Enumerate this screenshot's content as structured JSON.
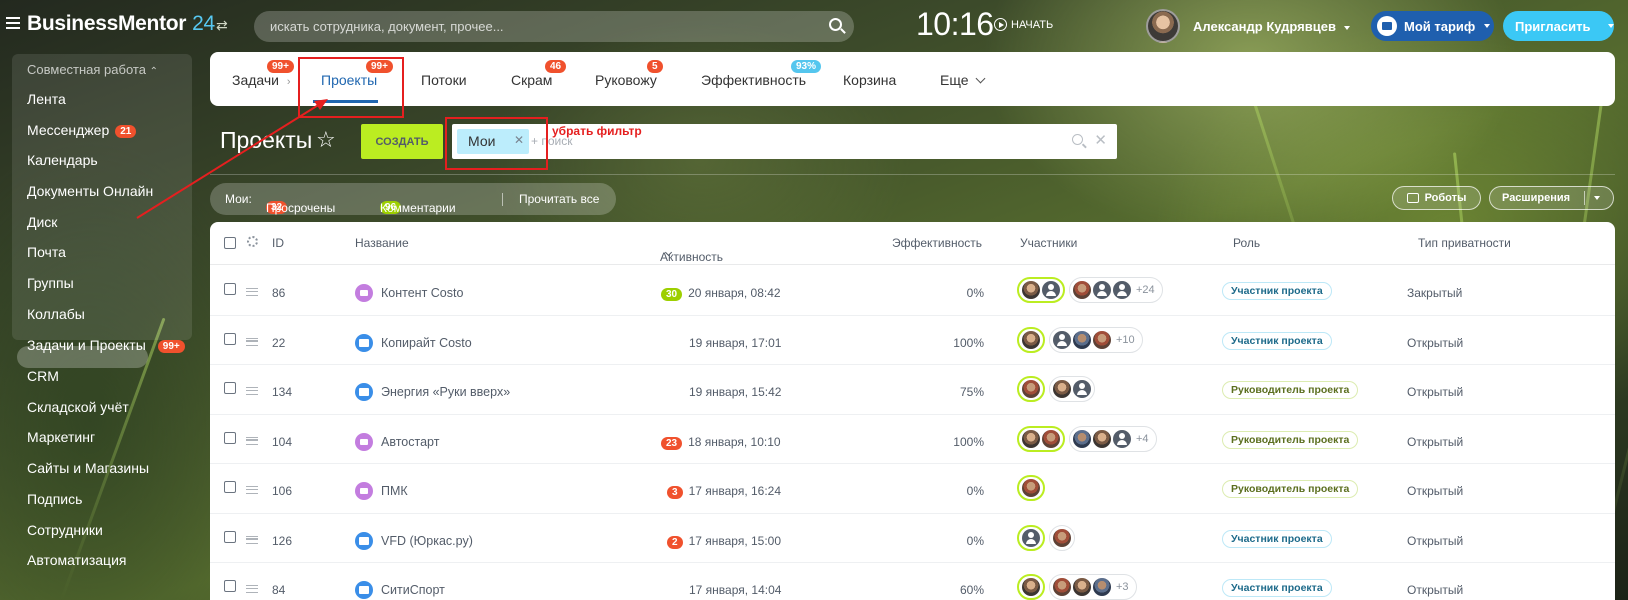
{
  "topbar": {
    "logo_brand": "BusinessMentor",
    "logo_num": "24",
    "search_placeholder": "искать сотрудника, документ, прочее...",
    "clock": "10:16",
    "start_label": "НАЧАТЬ",
    "user_name": "Александр Кудрявцев",
    "tariff_label": "Мой тариф",
    "invite_label": "Пригласить"
  },
  "sidebar": {
    "group_label": "Совместная работа",
    "items": [
      {
        "label": "Лента"
      },
      {
        "label": "Мессенджер",
        "badge": "21"
      },
      {
        "label": "Календарь"
      },
      {
        "label": "Документы Онлайн"
      },
      {
        "label": "Диск"
      },
      {
        "label": "Почта"
      },
      {
        "label": "Группы"
      },
      {
        "label": "Коллабы"
      },
      {
        "label": "Задачи и Проекты",
        "badge": "99+"
      },
      {
        "label": "CRM"
      },
      {
        "label": "Складской учёт"
      },
      {
        "label": "Маркетинг"
      },
      {
        "label": "Сайты и Магазины"
      },
      {
        "label": "Подпись"
      },
      {
        "label": "Сотрудники"
      },
      {
        "label": "Автоматизация"
      }
    ]
  },
  "tabs": [
    {
      "label": "Задачи",
      "badge": "99+"
    },
    {
      "label": "Проекты",
      "badge": "99+",
      "active": true
    },
    {
      "label": "Потоки"
    },
    {
      "label": "Скрам",
      "badge": "46"
    },
    {
      "label": "Руковожу",
      "badge": "5"
    },
    {
      "label": "Эффективность",
      "badge": "93%"
    },
    {
      "label": "Корзина"
    },
    {
      "label": "Еще"
    }
  ],
  "page": {
    "title": "Проекты",
    "create_label": "СОЗДАТЬ",
    "filter_chip": "Мои",
    "filter_placeholder": "+ поиск",
    "annotation": "убрать фильтр"
  },
  "counters": {
    "label": "Мои:",
    "overdue_count": "32",
    "overdue_label": "Просрочены",
    "comments_count": "96",
    "comments_label": "Комментарии",
    "read_all": "Прочитать все"
  },
  "actions": {
    "robots_label": "Роботы",
    "extensions_label": "Расширения"
  },
  "columns": {
    "id": "ID",
    "name": "Название",
    "activity": "Активность",
    "efficiency": "Эффективность",
    "members": "Участники",
    "role": "Роль",
    "privacy": "Тип приватности"
  },
  "rows": [
    {
      "id": "86",
      "name": "Контент Costo",
      "icon": "purple",
      "activity_badge": "30",
      "activity_badge_color": "green",
      "activity": "20 января, 08:42",
      "efficiency": "0%",
      "more": "+24",
      "role": "Участник проекта",
      "role_kind": "member",
      "privacy": "Закрытый"
    },
    {
      "id": "22",
      "name": "Копирайт Costo",
      "icon": "blue",
      "activity_badge": "",
      "activity": "19 января, 17:01",
      "efficiency": "100%",
      "more": "+10",
      "role": "Участник проекта",
      "role_kind": "member",
      "privacy": "Открытый"
    },
    {
      "id": "134",
      "name": "Энергия «Руки вверх»",
      "icon": "blue",
      "activity_badge": "",
      "activity": "19 января, 15:42",
      "efficiency": "75%",
      "more": "",
      "role": "Руководитель проекта",
      "role_kind": "owner",
      "privacy": "Открытый"
    },
    {
      "id": "104",
      "name": "Автостарт",
      "icon": "purple",
      "activity_badge": "23",
      "activity_badge_color": "red",
      "activity": "18 января, 10:10",
      "efficiency": "100%",
      "more": "+4",
      "role": "Руководитель проекта",
      "role_kind": "owner",
      "privacy": "Открытый"
    },
    {
      "id": "106",
      "name": "ПМК",
      "icon": "purple",
      "activity_badge": "3",
      "activity_badge_color": "red",
      "activity": "17 января, 16:24",
      "efficiency": "0%",
      "more": "",
      "role": "Руководитель проекта",
      "role_kind": "owner",
      "privacy": "Открытый"
    },
    {
      "id": "126",
      "name": "VFD (Юркас.ру)",
      "icon": "blue",
      "activity_badge": "2",
      "activity_badge_color": "red",
      "activity": "17 января, 15:00",
      "efficiency": "0%",
      "more": "",
      "role": "Участник проекта",
      "role_kind": "member",
      "privacy": "Открытый"
    },
    {
      "id": "84",
      "name": "СитиСпорт",
      "icon": "blue",
      "activity_badge": "",
      "activity": "17 января, 14:04",
      "efficiency": "60%",
      "more": "+3",
      "role": "Участник проекта",
      "role_kind": "member",
      "privacy": "Открытый"
    }
  ]
}
